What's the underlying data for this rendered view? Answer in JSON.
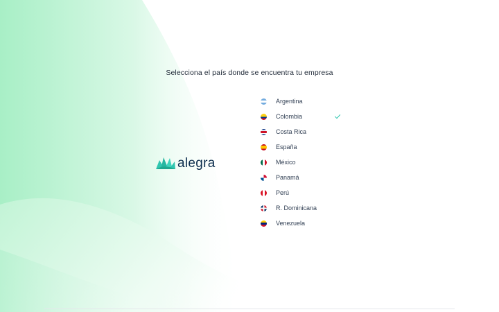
{
  "heading": "Selecciona el país donde se encuentra tu empresa",
  "logo": {
    "text": "alegra",
    "icon": "alegra-fan-icon",
    "brand_color": "#30c6b0",
    "text_color": "#0e2f4f"
  },
  "countries": [
    {
      "label": "Argentina",
      "flag": "argentina-flag-icon",
      "selected": false
    },
    {
      "label": "Colombia",
      "flag": "colombia-flag-icon",
      "selected": true
    },
    {
      "label": "Costa Rica",
      "flag": "costa-rica-flag-icon",
      "selected": false
    },
    {
      "label": "España",
      "flag": "spain-flag-icon",
      "selected": false
    },
    {
      "label": "México",
      "flag": "mexico-flag-icon",
      "selected": false
    },
    {
      "label": "Panamá",
      "flag": "panama-flag-icon",
      "selected": false
    },
    {
      "label": "Perú",
      "flag": "peru-flag-icon",
      "selected": false
    },
    {
      "label": "R. Dominicana",
      "flag": "dominican-republic-flag-icon",
      "selected": false
    },
    {
      "label": "Venezuela",
      "flag": "venezuela-flag-icon",
      "selected": false
    }
  ],
  "colors": {
    "accent_check": "#30c6b0",
    "background_gradient": "#c8f5dc"
  }
}
